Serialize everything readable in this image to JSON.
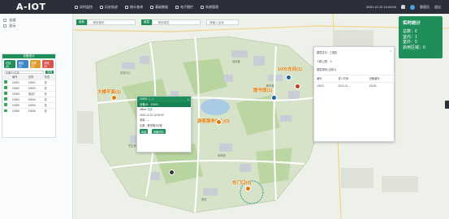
{
  "app": {
    "title": "A-IOT"
  },
  "nav": [
    {
      "label": "实时监控"
    },
    {
      "label": "历史轨迹"
    },
    {
      "label": "统计查询"
    },
    {
      "label": "基础数据"
    },
    {
      "label": "电子围栏"
    },
    {
      "label": "系统管理"
    }
  ],
  "header": {
    "datetime": "2020-12-22 10:00:00",
    "user": "管理员",
    "logout": "退出"
  },
  "left": {
    "checks": [
      {
        "label": "全部"
      },
      {
        "label": "显示"
      }
    ],
    "card_title": "设备统计",
    "tags": [
      {
        "label": "在线(6)",
        "color": "#1f8f5a"
      },
      {
        "label": "离线(0)",
        "color": "#3b86c8"
      },
      {
        "label": "告警(0)",
        "color": "#e09b2d"
      },
      {
        "label": "低电(0)",
        "color": "#d9534f"
      }
    ],
    "filter_placeholder": "设备ID/名称",
    "filter_btn": "查询",
    "columns": [
      "",
      "编号",
      "名称",
      "状态"
    ],
    "rows": [
      {
        "id": "10001",
        "name": "10001",
        "status": "在"
      },
      {
        "id": "10002",
        "name": "10002",
        "status": "在"
      },
      {
        "id": "10003",
        "name": "测试2",
        "status": "在"
      },
      {
        "id": "10004",
        "name": "10004",
        "status": "在"
      },
      {
        "id": "10005",
        "name": "10005",
        "status": "在"
      },
      {
        "id": "10006",
        "name": "10006",
        "status": "在"
      }
    ]
  },
  "search": {
    "label1": "楼栋",
    "placeholder1": "请选楼栋",
    "label2": "楼层",
    "placeholder2": "请选楼层",
    "placeholder3": "请输入坐标"
  },
  "map_labels": [
    {
      "text": "大楼平面(1)"
    },
    {
      "text": "游客服务中心(0)"
    },
    {
      "text": "1005车间(1)"
    },
    {
      "text": "图书馆(1)"
    },
    {
      "text": "东门口(0)"
    }
  ],
  "map_texts": [
    {
      "text": "实验中心"
    },
    {
      "text": "综合楼"
    },
    {
      "text": "教学楼"
    },
    {
      "text": "学生宿舍"
    },
    {
      "text": "体育馆"
    },
    {
      "text": "食堂"
    }
  ],
  "popup": {
    "title": "10001（...）",
    "id_line": "设备ID：10001",
    "status_line": "offline",
    "status_badge": "在线",
    "time_line": "2020-12-22 12:00:00",
    "battery": "电量：--",
    "address": "位置：教学楼303室",
    "btn1": "轨迹",
    "btn2": "设备详情"
  },
  "detail": {
    "header": "楼层名字：三楼区",
    "sub": "人数上限：人",
    "info": "楼层说明 (当前1)",
    "columns": [
      "编号",
      "进入时间",
      "设备编号"
    ],
    "row": [
      "10003",
      "2020-12-...",
      "10003"
    ]
  },
  "stats": {
    "title": "实时统计",
    "total": "总数：6",
    "indoor": "室内：1",
    "outdoor": "室外：5",
    "beacon": "启用区域：0"
  }
}
